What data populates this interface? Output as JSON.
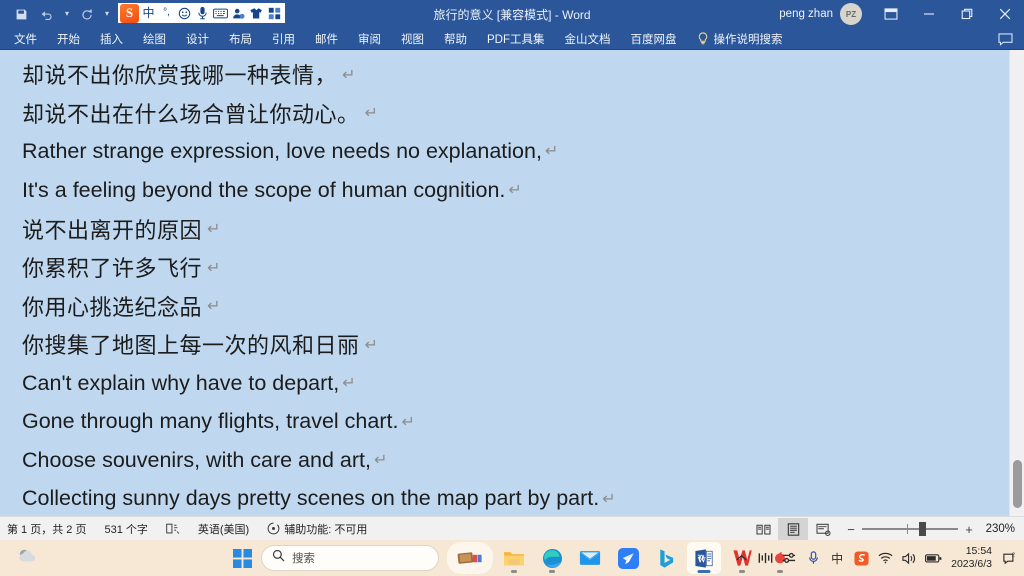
{
  "titlebar": {
    "document_title": "旅行的意义 [兼容模式]  -  Word",
    "quick_access": [
      {
        "name": "save",
        "icon": "save-icon"
      },
      {
        "name": "undo",
        "icon": "undo-icon"
      },
      {
        "name": "undo-dropdown",
        "icon": "chevron-down-icon"
      },
      {
        "name": "redo",
        "icon": "redo-icon"
      },
      {
        "name": "customize-qat",
        "icon": "chevron-down-icon"
      }
    ],
    "account_name": "peng zhan",
    "avatar_initials": "PZ",
    "window_buttons": [
      "ribbon-display-options",
      "minimize",
      "restore",
      "close"
    ]
  },
  "ime": {
    "logo": "S",
    "mode_label": "中",
    "punctuation_label": "°,",
    "items": [
      "sogou-logo",
      "chinese-mode",
      "punctuation-mode",
      "emoji",
      "voice-input",
      "soft-keyboard",
      "user-account",
      "skin",
      "toolbox"
    ]
  },
  "ribbon": {
    "tabs": [
      {
        "label": "文件",
        "id": "file"
      },
      {
        "label": "开始",
        "id": "home"
      },
      {
        "label": "插入",
        "id": "insert"
      },
      {
        "label": "绘图",
        "id": "draw"
      },
      {
        "label": "设计",
        "id": "design"
      },
      {
        "label": "布局",
        "id": "layout"
      },
      {
        "label": "引用",
        "id": "references"
      },
      {
        "label": "邮件",
        "id": "mailings"
      },
      {
        "label": "审阅",
        "id": "review"
      },
      {
        "label": "视图",
        "id": "view"
      },
      {
        "label": "帮助",
        "id": "help"
      },
      {
        "label": "PDF工具集",
        "id": "pdf-tools"
      },
      {
        "label": "金山文档",
        "id": "kingsoft-docs"
      },
      {
        "label": "百度网盘",
        "id": "baidu-netdisk"
      }
    ],
    "tell_me": "操作说明搜索",
    "comment_icon": "comment-icon"
  },
  "document": {
    "background_color": "#bfd8ef",
    "paragraph_mark": "↵",
    "lines": [
      {
        "text": "却说不出你欣赏我哪一种表情，",
        "lang": "cn"
      },
      {
        "text": "却说不出在什么场合曾让你动心。",
        "lang": "cn"
      },
      {
        "text": "Rather strange expression, love needs no explanation,",
        "lang": "en"
      },
      {
        "text": "It's a feeling beyond the scope of human cognition.",
        "lang": "en"
      },
      {
        "text": "说不出离开的原因",
        "lang": "cn"
      },
      {
        "text": "你累积了许多飞行",
        "lang": "cn"
      },
      {
        "text": "你用心挑选纪念品",
        "lang": "cn"
      },
      {
        "text": "你搜集了地图上每一次的风和日丽",
        "lang": "cn"
      },
      {
        "text": "Can't explain why have to depart,",
        "lang": "en"
      },
      {
        "text": "Gone through many flights, travel chart.",
        "lang": "en"
      },
      {
        "text": "Choose souvenirs, with care and art,",
        "lang": "en"
      },
      {
        "text": "Collecting sunny days pretty scenes on the map part by part.",
        "lang": "en"
      }
    ]
  },
  "statusbar": {
    "page_info": "第 1 页，共 2 页",
    "word_count": "531 个字",
    "proofing_icon": "proofing-errors-icon",
    "language": "英语(美国)",
    "accessibility": "辅助功能: 不可用",
    "views": [
      {
        "name": "read-mode",
        "active": false
      },
      {
        "name": "print-layout",
        "active": true
      },
      {
        "name": "web-layout",
        "active": false
      }
    ],
    "zoom_out": "−",
    "zoom_in": "+",
    "zoom_level": "230%"
  },
  "taskbar": {
    "weather_icon": "weather-cloud-icon",
    "start_icon": "windows-start-icon",
    "search_placeholder": "搜索",
    "apps": [
      {
        "name": "widgets",
        "icon": "widgets-icon",
        "active": false,
        "pill": true
      },
      {
        "name": "file-explorer",
        "icon": "folder-icon",
        "active": false,
        "running": true
      },
      {
        "name": "microsoft-edge",
        "icon": "edge-icon",
        "active": false,
        "running": true
      },
      {
        "name": "mail",
        "icon": "mail-icon",
        "active": false,
        "running": false
      },
      {
        "name": "bird-app",
        "icon": "bird-icon",
        "active": false,
        "running": false
      },
      {
        "name": "bing-chat",
        "icon": "bing-icon",
        "active": false,
        "running": false
      },
      {
        "name": "microsoft-word",
        "icon": "word-icon",
        "active": true,
        "running": true
      },
      {
        "name": "wps-office",
        "icon": "wps-icon",
        "active": false,
        "running": true
      },
      {
        "name": "red-app",
        "icon": "red-dot-icon",
        "active": false,
        "running": true
      }
    ],
    "tray": [
      {
        "name": "show-hidden-icons",
        "icon": "chevron-up-icon"
      },
      {
        "name": "audio-mixer",
        "icon": "equalizer-icon"
      },
      {
        "name": "quick-settings-sliders",
        "icon": "sliders-icon"
      },
      {
        "name": "microphone",
        "icon": "microphone-icon"
      },
      {
        "name": "ime-indicator",
        "icon": "chinese-ime-icon",
        "label": "中"
      },
      {
        "name": "sogou-tray",
        "icon": "sogou-icon",
        "label": "S"
      },
      {
        "name": "network",
        "icon": "wifi-icon"
      },
      {
        "name": "volume",
        "icon": "speaker-icon"
      },
      {
        "name": "battery",
        "icon": "battery-icon"
      }
    ],
    "clock_time": "15:54",
    "clock_date": "2023/6/3",
    "notification_icon": "notification-bell-icon"
  }
}
